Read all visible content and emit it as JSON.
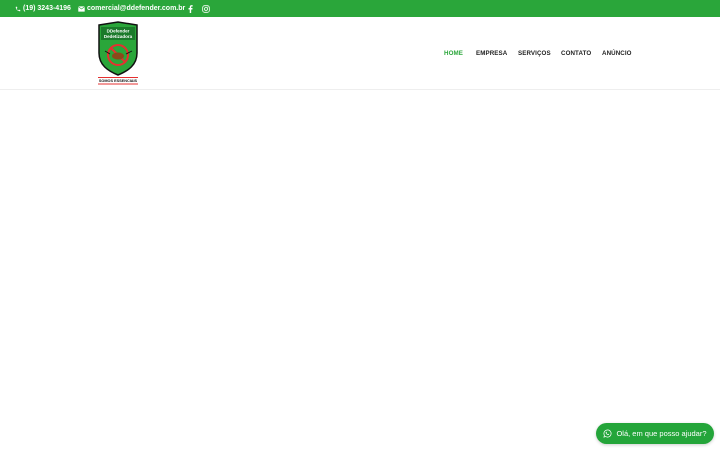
{
  "topbar": {
    "phone": "(19) 3243-4196",
    "email": "comercial@ddefender.com.br",
    "social": [
      "facebook-icon",
      "instagram-icon"
    ],
    "bg_color": "#2aa63a"
  },
  "logo": {
    "line1": "DDefender",
    "line2": "Dedetizadora",
    "tagline": "SOMOS ESSENCIAIS"
  },
  "nav": {
    "items": [
      {
        "label": "HOME",
        "active": true
      },
      {
        "label": "EMPRESA",
        "active": false
      },
      {
        "label": "SERVIÇOS",
        "active": false
      },
      {
        "label": "CONTATO",
        "active": false
      },
      {
        "label": "ANÚNCIO",
        "active": false
      }
    ],
    "active_color": "#2aa63a"
  },
  "whatsapp": {
    "label": "Olá, em que posso ajudar?",
    "icon": "whatsapp-icon",
    "color": "#24a53a"
  }
}
